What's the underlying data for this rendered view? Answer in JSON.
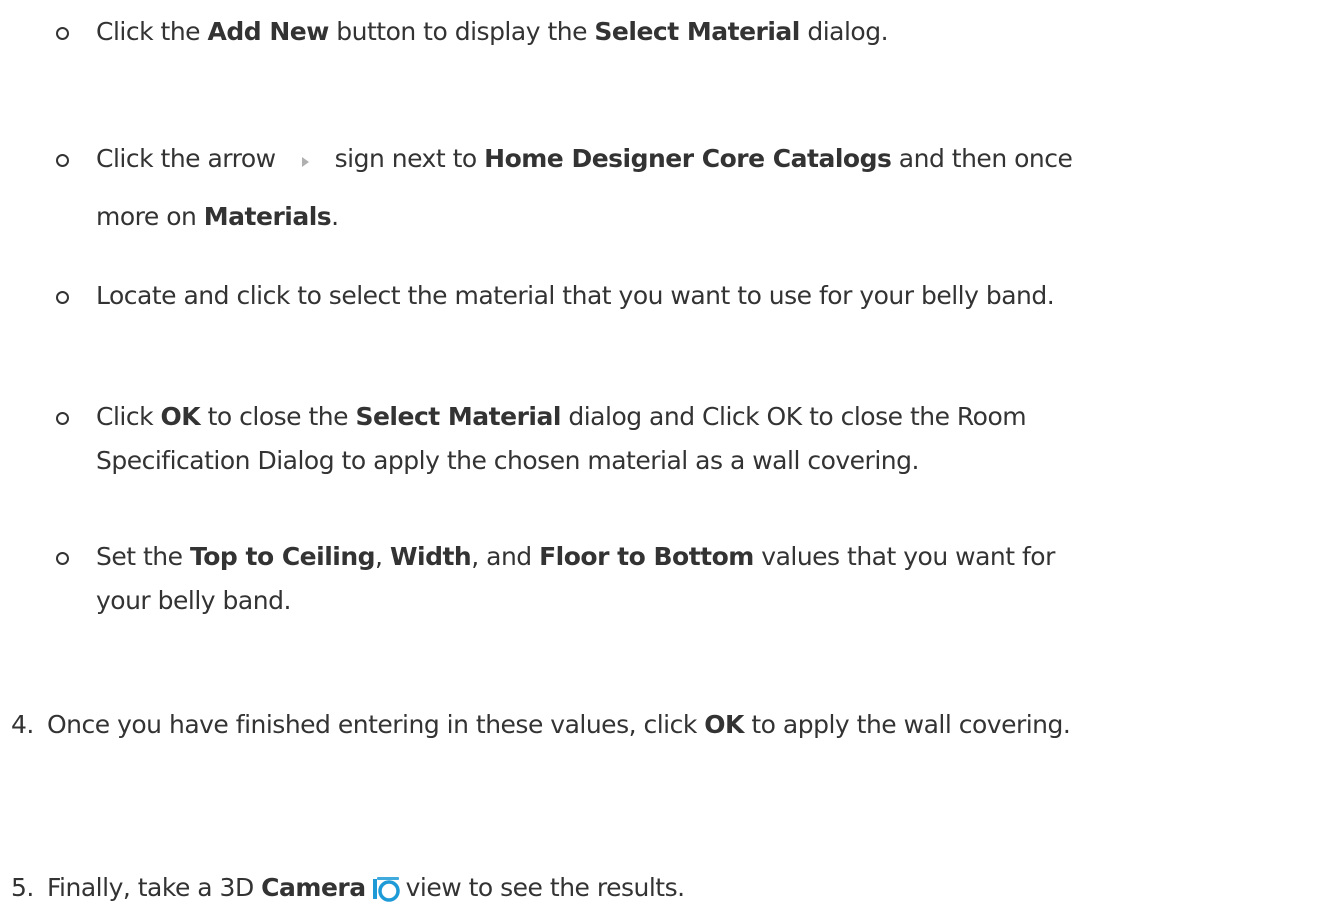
{
  "bullets": [
    {
      "parts": [
        {
          "t": "Click the "
        },
        {
          "t": "Add New",
          "b": true
        },
        {
          "t": " button to display the "
        },
        {
          "t": "Select Material",
          "b": true
        },
        {
          "t": " dialog."
        }
      ]
    },
    {
      "line1": [
        {
          "t": "Click the arrow"
        },
        {
          "icon": "arrow-icon"
        },
        {
          "t": "sign next to "
        },
        {
          "t": "Home Designer Core Catalogs",
          "b": true
        },
        {
          "t": " and then once"
        }
      ],
      "line2": [
        {
          "t": "more on "
        },
        {
          "t": "Materials",
          "b": true
        },
        {
          "t": "."
        }
      ]
    },
    {
      "parts": [
        {
          "t": "Locate and click to select the material that you want to use for your belly band."
        }
      ]
    },
    {
      "line1": [
        {
          "t": "Click "
        },
        {
          "t": "OK",
          "b": true
        },
        {
          "t": " to close the "
        },
        {
          "t": "Select Material",
          "b": true
        },
        {
          "t": " dialog and Click OK to close the Room"
        }
      ],
      "line2": [
        {
          "t": "Specification Dialog to apply the chosen material as a wall covering."
        }
      ]
    },
    {
      "line1": [
        {
          "t": "Set the "
        },
        {
          "t": "Top to Ceiling",
          "b": true
        },
        {
          "t": ", "
        },
        {
          "t": "Width",
          "b": true
        },
        {
          "t": ", and "
        },
        {
          "t": "Floor to Bottom",
          "b": true
        },
        {
          "t": " values that you want for"
        }
      ],
      "line2": [
        {
          "t": "your belly band."
        }
      ]
    }
  ],
  "steps": [
    {
      "number": "4.",
      "parts": [
        {
          "t": "Once you have finished entering in these values, click "
        },
        {
          "t": "OK",
          "b": true
        },
        {
          "t": " to apply the wall covering."
        }
      ]
    },
    {
      "number": "5.",
      "parts": [
        {
          "t": "Finally, take a 3D "
        },
        {
          "t": "Camera",
          "b": true
        },
        {
          "icon": "camera-icon"
        },
        {
          "t": "view to see the results."
        }
      ]
    }
  ],
  "colors": {
    "text": "#333333",
    "camera_blue": "#1e9bd7"
  }
}
